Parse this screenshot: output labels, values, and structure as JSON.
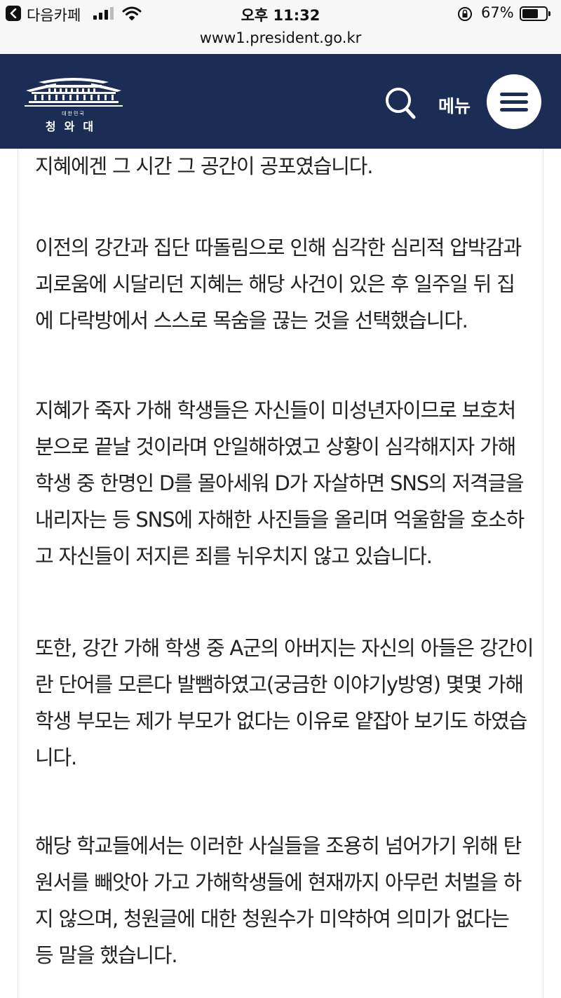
{
  "status_bar": {
    "app_name": "다음카페",
    "time": "오후 11:32",
    "battery": "67%"
  },
  "url": "www1.president.go.kr",
  "header": {
    "logo_small": "대한민국",
    "logo_name": "청와대",
    "menu_label": "메뉴"
  },
  "article": {
    "paragraphs": [
      {
        "lines": [
          "지혜에겐 그 시간 그 공간이 공포였습니다."
        ]
      },
      {
        "lines": [
          "이전의 강간과 집단 따돌림으로 인해 심각한 심리적 압박감과",
          "괴로움에 시달리던 지혜는 해당 사건이 있은 후 일주일 뒤 집",
          "에 다락방에서 스스로 목숨을 끊는 것을 선택했습니다."
        ]
      },
      {
        "lines": [
          "지혜가 죽자 가해 학생들은 자신들이 미성년자이므로 보호처",
          "분으로 끝날 것이라며 안일해하였고 상황이 심각해지자 가해",
          "학생 중 한명인 D를 몰아세워 D가 자살하면 SNS의 저격글을",
          "내리자는 등 SNS에 자해한 사진들을 올리며 억울함을 호소하",
          "고 자신들이 저지른 죄를 뉘우치지 않고 있습니다."
        ]
      },
      {
        "lines": [
          "또한, 강간 가해 학생 중 A군의 아버지는 자신의 아들은 강간이",
          "란 단어를 모른다 발뺌하였고(궁금한 이야기y방영) 몇몇 가해",
          "학생 부모는 제가 부모가 없다는 이유로 얕잡아 보기도 하였습",
          "니다."
        ]
      },
      {
        "lines": [
          "해당 학교들에서는 이러한 사실들을 조용히 넘어가기 위해 탄",
          "원서를 빼앗아 가고 가해학생들에 현재까지 아무런 처벌을 하",
          "지 않으며, 청원글에 대한 청원수가 미약하여 의미가 없다는",
          "등 말을 했습니다."
        ]
      }
    ]
  }
}
